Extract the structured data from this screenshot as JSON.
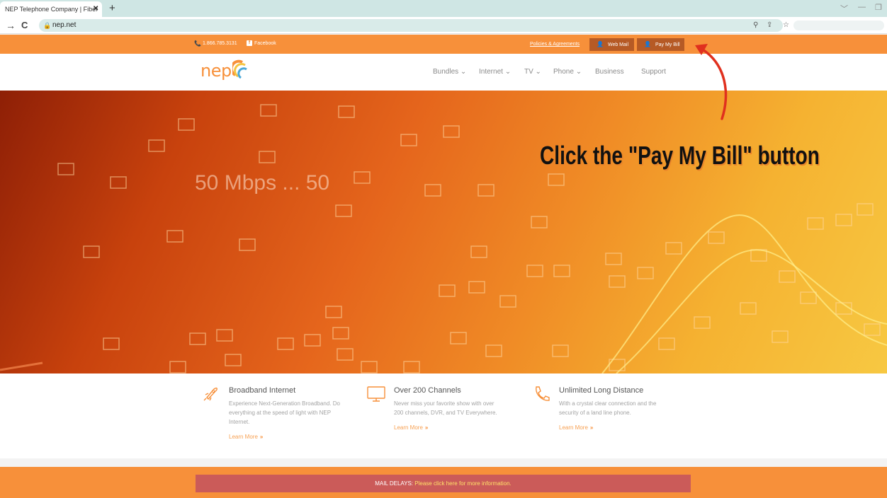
{
  "browser": {
    "tab_title": "NEP Telephone Company | Fiber",
    "tab_close": "✕",
    "new_tab": "+",
    "url": "nep.net",
    "window_controls": [
      "﹀",
      "—",
      "❐"
    ]
  },
  "topbar": {
    "phone": "1.866.785.3131",
    "facebook": "Facebook",
    "policies": "Policies & Agreements",
    "web_mail": "Web Mail",
    "pay_my_bill": "Pay My Bill"
  },
  "header": {
    "logo": "nep",
    "nav": [
      {
        "label": "Bundles ⌄"
      },
      {
        "label": "Internet ⌄"
      },
      {
        "label": "TV ⌄"
      },
      {
        "label": "Phone ⌄"
      },
      {
        "label": "Business"
      },
      {
        "label": "Support"
      }
    ]
  },
  "hero": {
    "headline": "50 Mbps ... 50",
    "callout": "Click the \"Pay My Bill\" button"
  },
  "features": [
    {
      "title": "Broadband Internet",
      "desc_1": "Experience Next-Generation Broadband. Do",
      "desc_2": "everything at the speed of light with NEP",
      "desc_3": "Internet.",
      "link": "Learn More",
      "arrow": "»",
      "icon": "rocket-icon"
    },
    {
      "title": "Over 200 Channels",
      "desc_1": "Never miss your favorite show with over",
      "desc_2": "200 channels, DVR, and TV Everywhere.",
      "desc_3": "",
      "link": "Learn More",
      "arrow": "»",
      "icon": "monitor-icon"
    },
    {
      "title": "Unlimited Long Distance",
      "desc_1": "With a crystal clear connection and the",
      "desc_2": "security of a land line phone.",
      "desc_3": "",
      "link": "Learn More",
      "arrow": "»",
      "icon": "phone-handset-icon"
    }
  ],
  "footer": {
    "label": "MAIL DELAYS:",
    "link": "Please click here for more information."
  },
  "colors": {
    "brand_orange": "#f7903a",
    "button_brown": "#b65a25",
    "notice_red": "#cb5b59",
    "arrow_red": "#e0301e"
  }
}
